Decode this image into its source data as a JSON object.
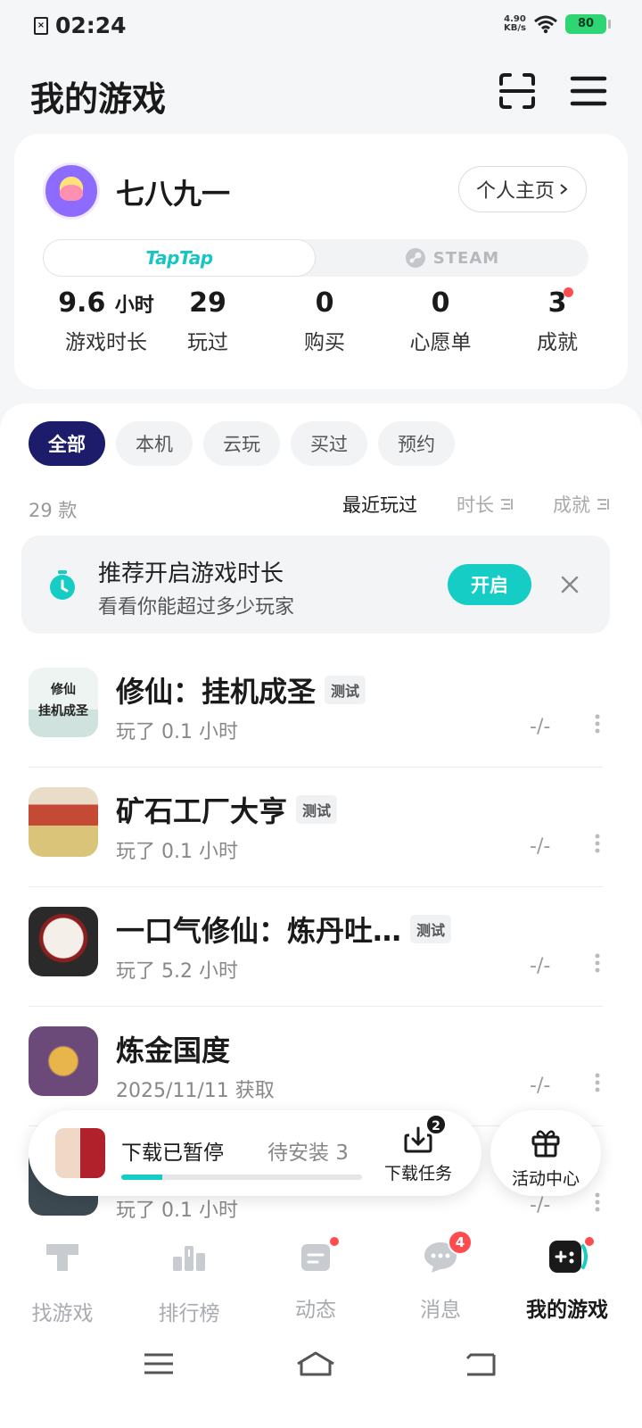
{
  "status_bar": {
    "time": "02:24",
    "net_speed_value": "4.90",
    "net_speed_unit": "KB/s",
    "battery": "80"
  },
  "header": {
    "title": "我的游戏"
  },
  "profile": {
    "name": "七八九一",
    "homepage_label": "个人主页",
    "platforms": {
      "taptap": "TapTap",
      "steam": "STEAM",
      "selected": "TapTap"
    },
    "stats": [
      {
        "value": "9.6",
        "unit": "小时",
        "label": "游戏时长"
      },
      {
        "value": "29",
        "label": "玩过"
      },
      {
        "value": "0",
        "label": "购买"
      },
      {
        "value": "0",
        "label": "心愿单"
      },
      {
        "value": "3",
        "label": "成就"
      }
    ]
  },
  "filters": {
    "items": [
      "全部",
      "本机",
      "云玩",
      "买过",
      "预约"
    ],
    "selected": "全部"
  },
  "list_meta": {
    "count": "29 款"
  },
  "sort": {
    "items": [
      "最近玩过",
      "时长",
      "成就"
    ],
    "selected": "最近玩过"
  },
  "recommendation": {
    "title": "推荐开启游戏时长",
    "subtitle": "看看你能超过多少玩家",
    "button": "开启"
  },
  "games": [
    {
      "name": "修仙：挂机成圣",
      "badge": "测试",
      "sub": "玩了 0.1 小时",
      "rating": "-/-",
      "icon_text_1": "修仙",
      "icon_text_2": "挂机成圣"
    },
    {
      "name": "矿石工厂大亨",
      "badge": "测试",
      "sub": "玩了 0.1 小时",
      "rating": "-/-"
    },
    {
      "name": "一口气修仙：炼丹吐…",
      "badge": "测试",
      "sub": "玩了 5.2 小时",
      "rating": "-/-"
    },
    {
      "name": "炼金国度",
      "sub": "2025/11/11 获取",
      "rating": "-/-"
    },
    {
      "name": "",
      "sub": "玩了 0.1 小时",
      "rating": "-/-"
    }
  ],
  "download": {
    "status": "下载已暂停",
    "pending": "待安装 3",
    "progress": 0.17,
    "task_label": "下载任务",
    "task_count": "2"
  },
  "activity": {
    "label": "活动中心"
  },
  "bottom_nav": {
    "items": [
      {
        "label": "找游戏"
      },
      {
        "label": "排行榜"
      },
      {
        "label": "动态"
      },
      {
        "label": "消息",
        "badge": "4"
      },
      {
        "label": "我的游戏"
      }
    ],
    "selected": "我的游戏"
  },
  "colors": {
    "accent": "#15cdc4",
    "chip_active": "#1c1c6b",
    "alert": "#ff4d4f",
    "battery": "#2ed573"
  }
}
